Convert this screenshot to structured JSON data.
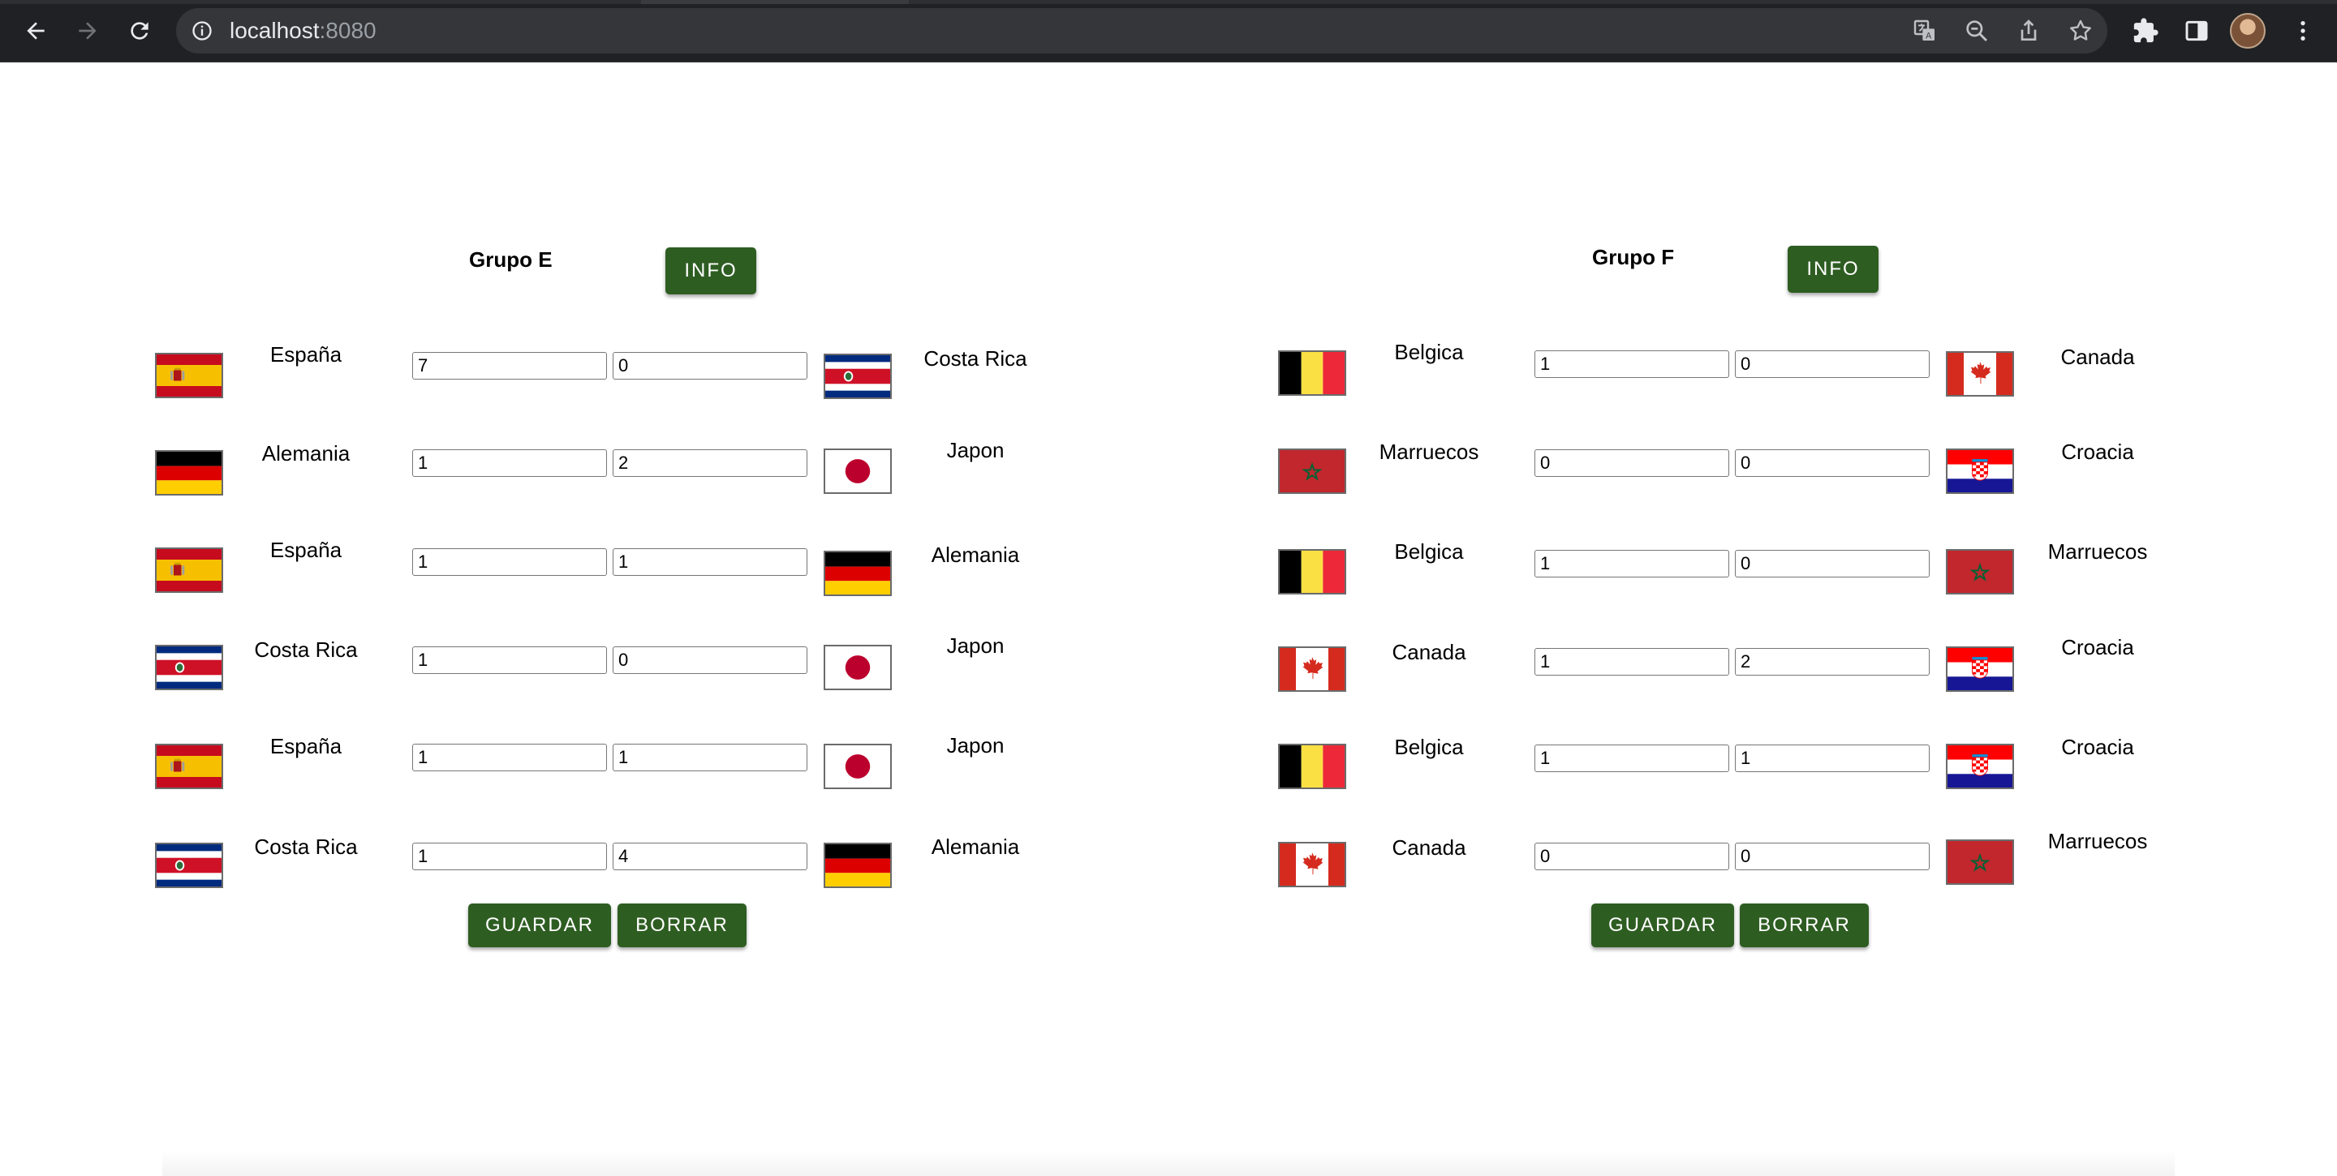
{
  "browser": {
    "url_host": "localhost",
    "url_port": ":8080"
  },
  "groups": [
    {
      "title": "Grupo E",
      "info_label": "INFO",
      "save_label": "GUARDAR",
      "delete_label": "BORRAR",
      "matches": [
        {
          "home": "España",
          "home_flag": "spain",
          "home_score": "7",
          "away_score": "0",
          "away": "Costa Rica",
          "away_flag": "costa-rica"
        },
        {
          "home": "Alemania",
          "home_flag": "germany",
          "home_score": "1",
          "away_score": "2",
          "away": "Japon",
          "away_flag": "japan"
        },
        {
          "home": "España",
          "home_flag": "spain",
          "home_score": "1",
          "away_score": "1",
          "away": "Alemania",
          "away_flag": "germany"
        },
        {
          "home": "Costa Rica",
          "home_flag": "costa-rica",
          "home_score": "1",
          "away_score": "0",
          "away": "Japon",
          "away_flag": "japan"
        },
        {
          "home": "España",
          "home_flag": "spain",
          "home_score": "1",
          "away_score": "1",
          "away": "Japon",
          "away_flag": "japan"
        },
        {
          "home": "Costa Rica",
          "home_flag": "costa-rica",
          "home_score": "1",
          "away_score": "4",
          "away": "Alemania",
          "away_flag": "germany"
        }
      ]
    },
    {
      "title": "Grupo F",
      "info_label": "INFO",
      "save_label": "GUARDAR",
      "delete_label": "BORRAR",
      "matches": [
        {
          "home": "Belgica",
          "home_flag": "belgium",
          "home_score": "1",
          "away_score": "0",
          "away": "Canada",
          "away_flag": "canada"
        },
        {
          "home": "Marruecos",
          "home_flag": "morocco",
          "home_score": "0",
          "away_score": "0",
          "away": "Croacia",
          "away_flag": "croatia"
        },
        {
          "home": "Belgica",
          "home_flag": "belgium",
          "home_score": "1",
          "away_score": "0",
          "away": "Marruecos",
          "away_flag": "morocco"
        },
        {
          "home": "Canada",
          "home_flag": "canada",
          "home_score": "1",
          "away_score": "2",
          "away": "Croacia",
          "away_flag": "croatia"
        },
        {
          "home": "Belgica",
          "home_flag": "belgium",
          "home_score": "1",
          "away_score": "1",
          "away": "Croacia",
          "away_flag": "croatia"
        },
        {
          "home": "Canada",
          "home_flag": "canada",
          "home_score": "0",
          "away_score": "0",
          "away": "Marruecos",
          "away_flag": "morocco"
        }
      ]
    }
  ],
  "colors": {
    "button_green": "#2e5d22",
    "chrome_dark": "#202124"
  }
}
